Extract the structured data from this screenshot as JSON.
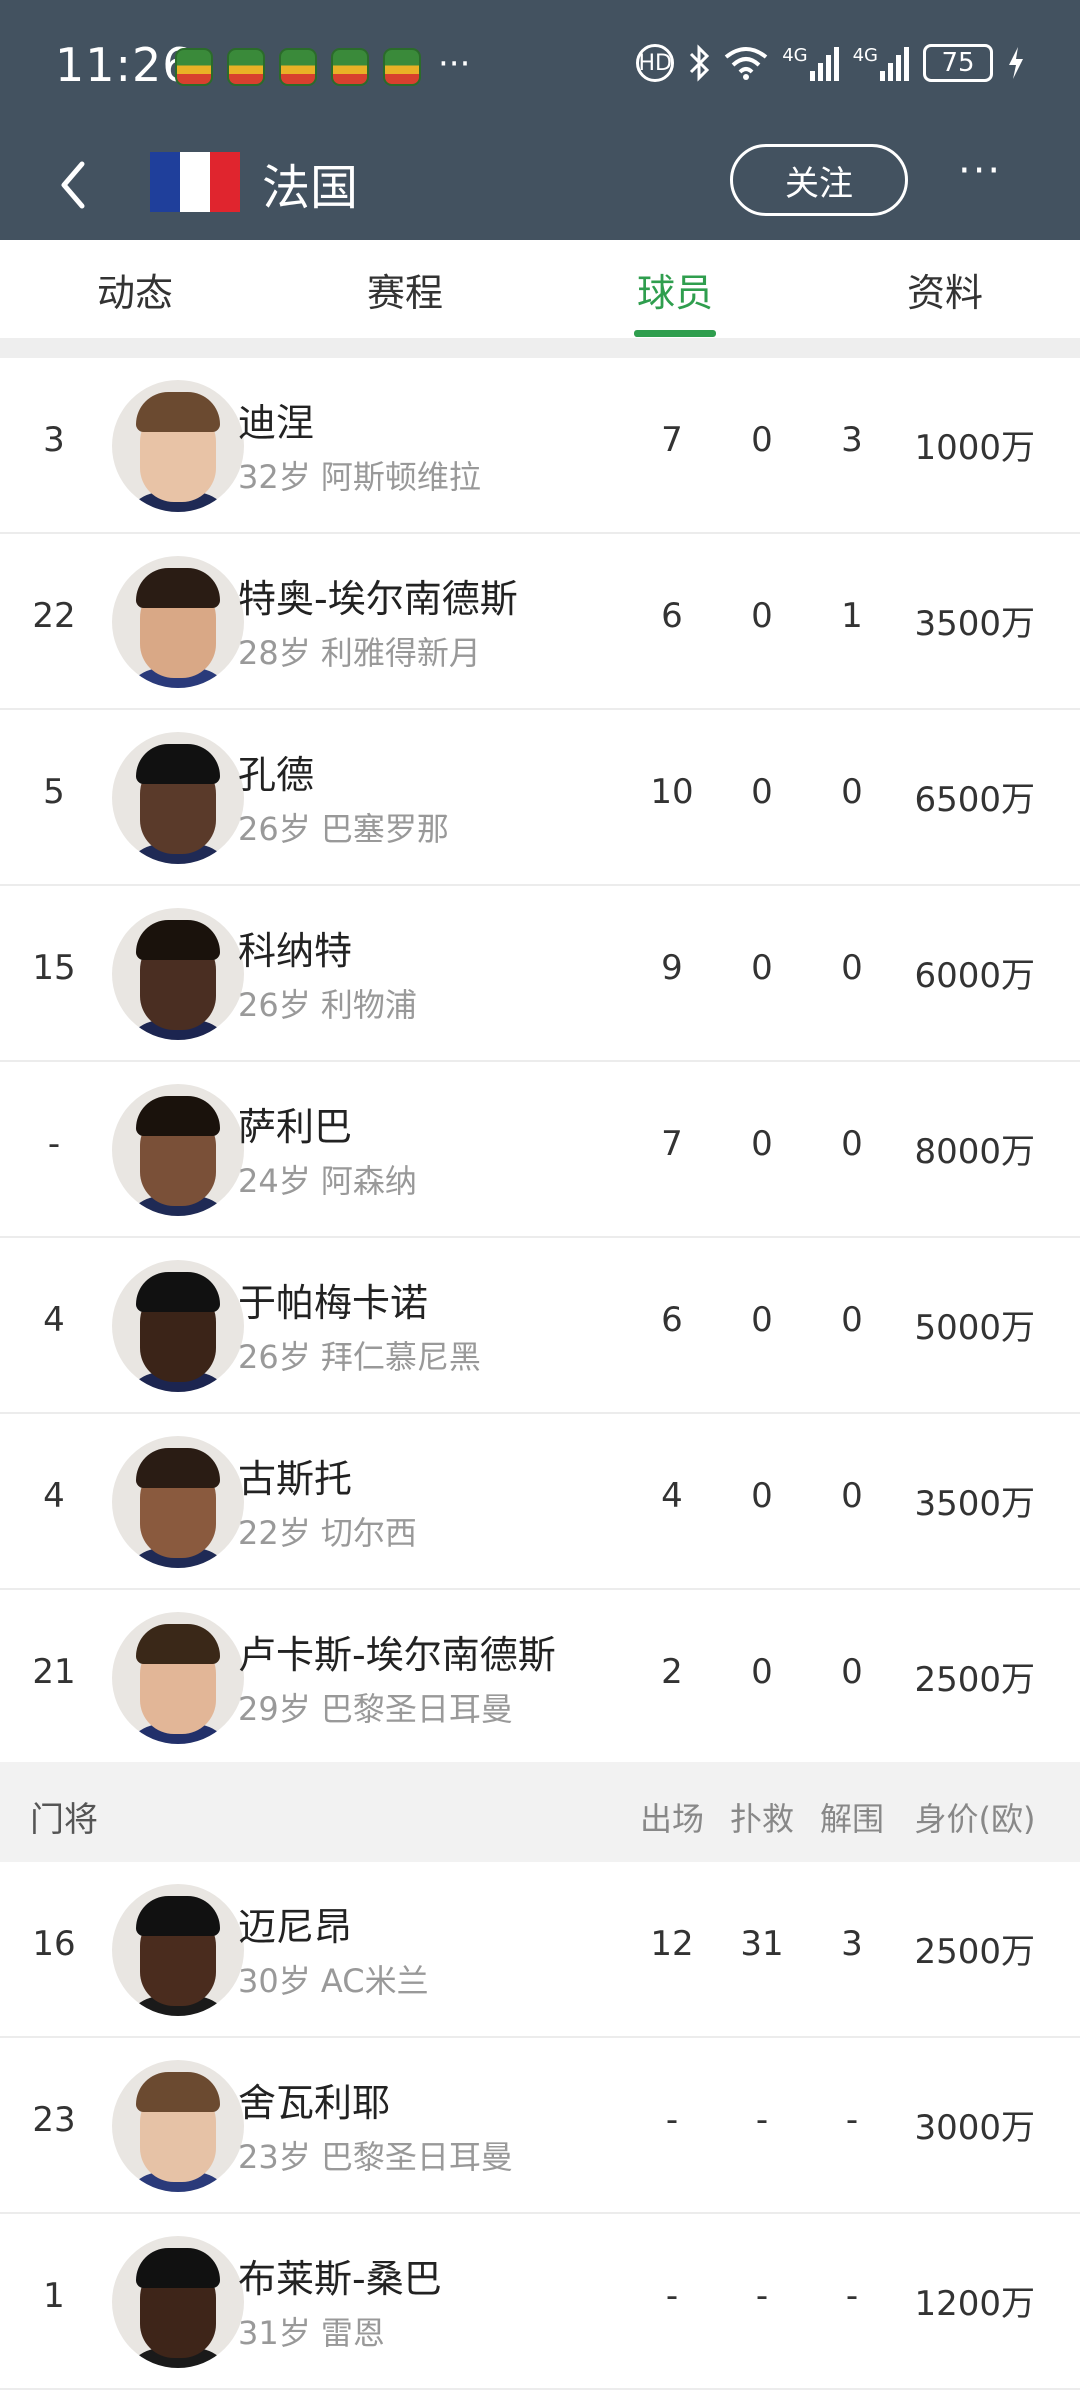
{
  "status": {
    "time": "11:26",
    "more": "···",
    "hd": "HD",
    "net1": "4G",
    "net2": "4G",
    "battery": "75"
  },
  "nav": {
    "team_name": "法国",
    "follow_label": "关注",
    "menu_label": "···",
    "flag_colors": [
      "#1f3f9b",
      "#ffffff",
      "#e0252e"
    ]
  },
  "tabs": [
    {
      "label": "动态"
    },
    {
      "label": "赛程"
    },
    {
      "label": "球员"
    },
    {
      "label": "资料"
    }
  ],
  "active_tab": "球员",
  "accent_color": "#2f9e4e",
  "defenders": [
    {
      "num": "3",
      "name": "迪涅",
      "info": "32岁 阿斯顿维拉",
      "s1": "7",
      "s2": "0",
      "s3": "3",
      "value": "1000万"
    },
    {
      "num": "22",
      "name": "特奥-埃尔南德斯",
      "info": "28岁 利雅得新月",
      "s1": "6",
      "s2": "0",
      "s3": "1",
      "value": "3500万"
    },
    {
      "num": "5",
      "name": "孔德",
      "info": "26岁 巴塞罗那",
      "s1": "10",
      "s2": "0",
      "s3": "0",
      "value": "6500万"
    },
    {
      "num": "15",
      "name": "科纳特",
      "info": "26岁 利物浦",
      "s1": "9",
      "s2": "0",
      "s3": "0",
      "value": "6000万"
    },
    {
      "num": "-",
      "name": "萨利巴",
      "info": "24岁 阿森纳",
      "s1": "7",
      "s2": "0",
      "s3": "0",
      "value": "8000万"
    },
    {
      "num": "4",
      "name": "于帕梅卡诺",
      "info": "26岁 拜仁慕尼黑",
      "s1": "6",
      "s2": "0",
      "s3": "0",
      "value": "5000万"
    },
    {
      "num": "4",
      "name": "古斯托",
      "info": "22岁 切尔西",
      "s1": "4",
      "s2": "0",
      "s3": "0",
      "value": "3500万"
    },
    {
      "num": "21",
      "name": "卢卡斯-埃尔南德斯",
      "info": "29岁 巴黎圣日耳曼",
      "s1": "2",
      "s2": "0",
      "s3": "0",
      "value": "2500万"
    }
  ],
  "gk_section": {
    "title": "门将",
    "col1": "出场",
    "col2": "扑救",
    "col3": "解围",
    "col4": "身价(欧)"
  },
  "goalkeepers": [
    {
      "num": "16",
      "name": "迈尼昂",
      "info": "30岁 AC米兰",
      "s1": "12",
      "s2": "31",
      "s3": "3",
      "value": "2500万"
    },
    {
      "num": "23",
      "name": "舍瓦利耶",
      "info": "23岁 巴黎圣日耳曼",
      "s1": "-",
      "s2": "-",
      "s3": "-",
      "value": "3000万"
    },
    {
      "num": "1",
      "name": "布莱斯-桑巴",
      "info": "31岁 雷恩",
      "s1": "-",
      "s2": "-",
      "s3": "-",
      "value": "1200万"
    }
  ]
}
